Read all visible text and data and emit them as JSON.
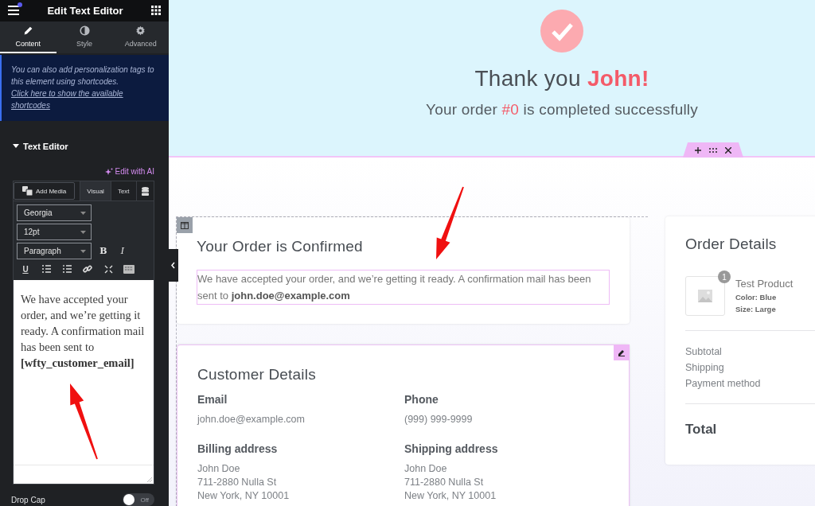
{
  "panel": {
    "title": "Edit Text Editor",
    "tabs": [
      {
        "label": "Content",
        "selected": true
      },
      {
        "label": "Style",
        "selected": false
      },
      {
        "label": "Advanced",
        "selected": false
      }
    ],
    "notice": {
      "text": "You can also add personalization tags to this element using shortcodes. ",
      "link": "Click here to show the available shortcodes"
    },
    "section": {
      "title": "Text Editor",
      "expanded": true
    },
    "ai_button": "Edit with AI",
    "add_media": "Add Media",
    "editor_tabs": [
      {
        "label": "Visual",
        "selected": true
      },
      {
        "label": "Text",
        "selected": false
      }
    ],
    "font_family": "Georgia",
    "font_size": "12pt",
    "block_format": "Paragraph",
    "format_buttons": [
      "B",
      "I"
    ],
    "underline_button": "U",
    "content": {
      "text": "We have accepted your order, and we’re getting it ready. A confirmation mail has been sent to ",
      "shortcode": "[wfty_customer_email]"
    },
    "drop_cap": {
      "label": "Drop Cap",
      "on": false,
      "state_text": "Off"
    }
  },
  "hero": {
    "title": "Thank you **John!**",
    "subtitle": [
      {
        "text": "Your order ",
        "highlight": false
      },
      {
        "text": "#0",
        "highlight": true
      },
      {
        "text": " is completed successfully",
        "highlight": false
      }
    ]
  },
  "confirmation": {
    "title": "Your Order is Confirmed",
    "text": "We have accepted your order, and we’re getting it ready. A confirmation mail has been sent to **john.doe@example.com**"
  },
  "customer": {
    "title": "Customer Details",
    "fields": [
      {
        "label": "Email",
        "lines": [
          "john.doe@example.com"
        ]
      },
      {
        "label": "Phone",
        "lines": [
          "(999) 999-9999"
        ]
      },
      {
        "label": "Billing address",
        "lines": [
          "John Doe",
          "711-2880 Nulla St",
          "New York, NY 10001"
        ]
      },
      {
        "label": "Shipping address",
        "lines": [
          "John Doe",
          "711-2880 Nulla St",
          "New York, NY 10001"
        ]
      }
    ]
  },
  "order": {
    "title": "Order Details",
    "items": [
      {
        "name": "Test Product",
        "quantity": "1",
        "meta": [
          "Color: Blue",
          "Size: Large"
        ]
      }
    ],
    "rows": [
      "Subtotal",
      "Shipping",
      "Payment method"
    ],
    "total": "Total"
  }
}
